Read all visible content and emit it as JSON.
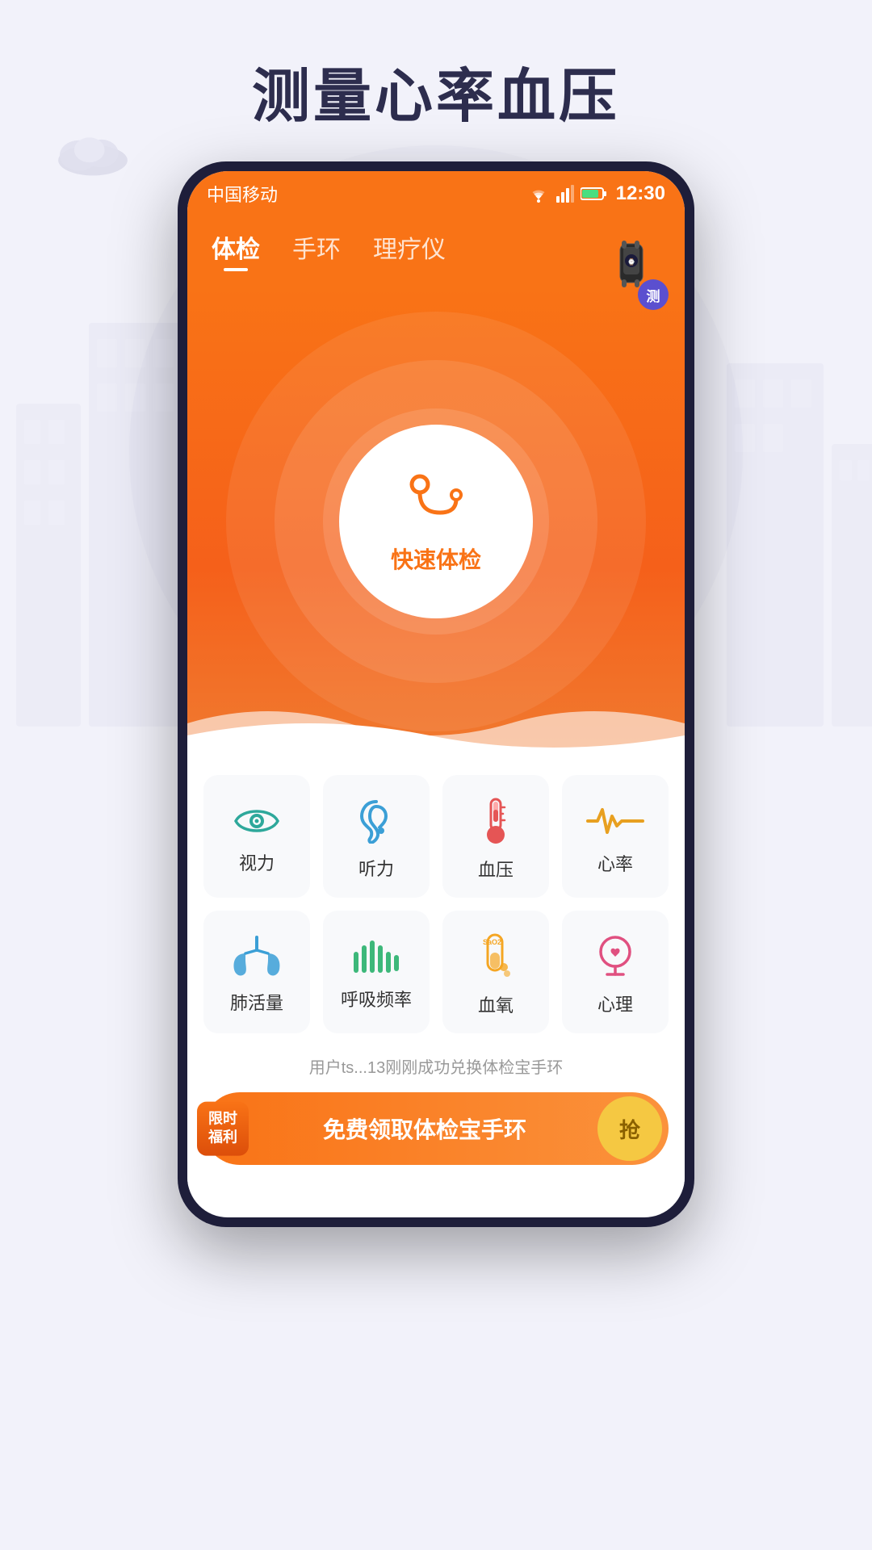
{
  "page": {
    "title": "测量心率血压",
    "background_color": "#f2f2fa"
  },
  "status_bar": {
    "carrier": "中国移动",
    "time": "12:30",
    "wifi_icon": "wifi",
    "signal_icon": "signal",
    "battery_icon": "battery"
  },
  "nav_tabs": [
    {
      "label": "体检",
      "active": true
    },
    {
      "label": "手环",
      "active": false
    },
    {
      "label": "理疗仪",
      "active": false
    }
  ],
  "watch_badge": {
    "label": "测"
  },
  "center_button": {
    "label": "快速体检",
    "icon": "stethoscope"
  },
  "health_items": [
    {
      "id": "vision",
      "label": "视力",
      "icon": "eye",
      "color": "#2ea89b"
    },
    {
      "id": "hearing",
      "label": "听力",
      "icon": "ear",
      "color": "#3b9fd6"
    },
    {
      "id": "bp",
      "label": "血压",
      "icon": "thermometer",
      "color": "#e55555"
    },
    {
      "id": "heartrate",
      "label": "心率",
      "icon": "heartbeat",
      "color": "#e8a020"
    },
    {
      "id": "lung",
      "label": "肺活量",
      "icon": "lungs",
      "color": "#3b9fd6"
    },
    {
      "id": "breath",
      "label": "呼吸频率",
      "icon": "waveform",
      "color": "#3db87a"
    },
    {
      "id": "oxygen",
      "label": "血氧",
      "icon": "oxygen",
      "color": "#f5a623"
    },
    {
      "id": "mental",
      "label": "心理",
      "icon": "brain",
      "color": "#e05080"
    }
  ],
  "notification": {
    "text": "用户ts...13刚刚成功兑换体检宝手环"
  },
  "banner": {
    "badge_line1": "限时",
    "badge_line2": "福利",
    "text": "免费领取体检宝手环",
    "grab_label": "抢"
  }
}
